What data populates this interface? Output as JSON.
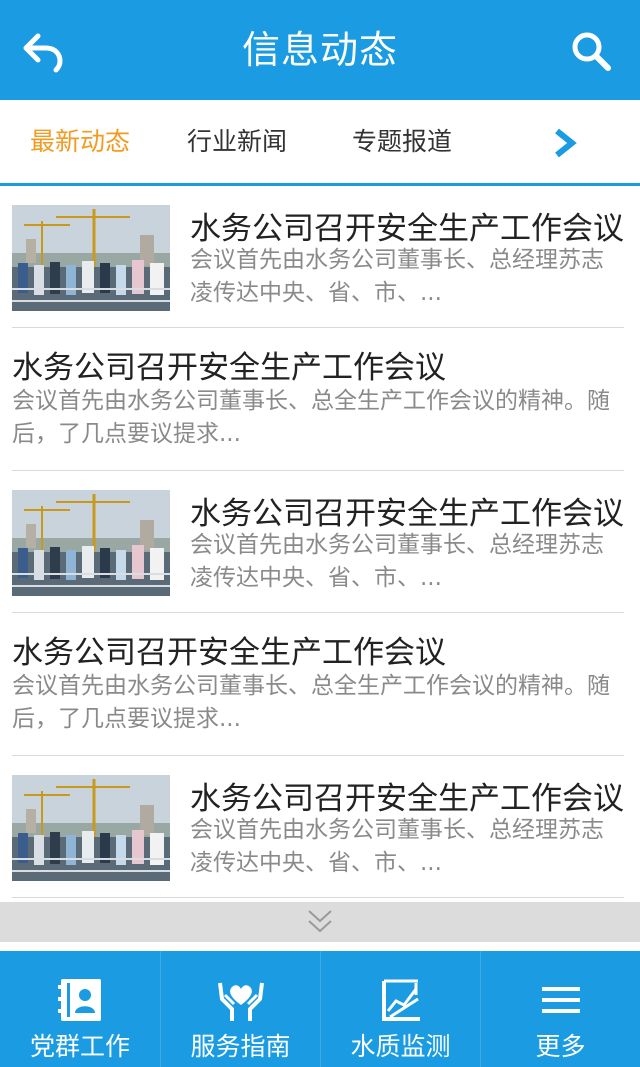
{
  "header": {
    "title": "信息动态",
    "back_icon": "back-arrow-icon",
    "search_icon": "search-icon"
  },
  "tabs": {
    "items": [
      {
        "label": "最新动态",
        "active": true
      },
      {
        "label": "行业新闻",
        "active": false
      },
      {
        "label": "专题报道",
        "active": false
      }
    ],
    "next_icon": "chevron-right-icon"
  },
  "news": [
    {
      "type": "image",
      "title": "水务公司召开安全生产工作会议",
      "desc": "会议首先由水务公司董事长、总经理苏志凌传达中央、省、市、..."
    },
    {
      "type": "text",
      "title": "水务公司召开安全生产工作会议",
      "desc": "会议首先由水务公司董事长、总全生产工作会议的精神。随后，了几点要议提求..."
    },
    {
      "type": "image",
      "title": "水务公司召开安全生产工作会议",
      "desc": "会议首先由水务公司董事长、总经理苏志凌传达中央、省、市、..."
    },
    {
      "type": "text",
      "title": "水务公司召开安全生产工作会议",
      "desc": "会议首先由水务公司董事长、总全生产工作会议的精神。随后，了几点要议提求..."
    },
    {
      "type": "image",
      "title": "水务公司召开安全生产工作会议",
      "desc": "会议首先由水务公司董事长、总经理苏志凌传达中央、省、市、..."
    }
  ],
  "more_icon": "double-chevron-down-icon",
  "bottom_nav": [
    {
      "label": "党群工作",
      "icon": "contacts-book-icon"
    },
    {
      "label": "服务指南",
      "icon": "hands-heart-icon"
    },
    {
      "label": "水质监测",
      "icon": "chart-report-icon"
    },
    {
      "label": "更多",
      "icon": "menu-icon"
    }
  ],
  "colors": {
    "brand": "#1a9be2",
    "active_tab": "#f29b21",
    "description": "#8a8a8a"
  }
}
